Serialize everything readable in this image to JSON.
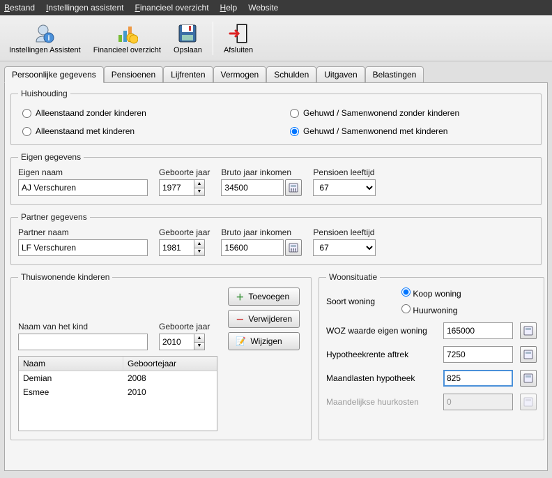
{
  "menu": {
    "bestand": "Bestand",
    "instellingen": "Instellingen assistent",
    "financieel": "Financieel overzicht",
    "help": "Help",
    "website": "Website"
  },
  "toolbar": {
    "instellingen": "Instellingen Assistent",
    "financieel": "Financieel overzicht",
    "opslaan": "Opslaan",
    "afsluiten": "Afsluiten"
  },
  "tabs": [
    "Persoonlijke gegevens",
    "Pensioenen",
    "Lijfrenten",
    "Vermogen",
    "Schulden",
    "Uitgaven",
    "Belastingen"
  ],
  "huishouding": {
    "legend": "Huishouding",
    "opt1": "Alleenstaand zonder kinderen",
    "opt2": "Gehuwd / Samenwonend zonder kinderen",
    "opt3": "Alleenstaand met kinderen",
    "opt4": "Gehuwd / Samenwonend met kinderen"
  },
  "eigen": {
    "legend": "Eigen gegevens",
    "naam_lbl": "Eigen naam",
    "naam": "AJ Verschuren",
    "geboorte_lbl": "Geboorte jaar",
    "geboorte": "1977",
    "bruto_lbl": "Bruto jaar inkomen",
    "bruto": "34500",
    "pensioen_lbl": "Pensioen leeftijd",
    "pensioen": "67"
  },
  "partner": {
    "legend": "Partner gegevens",
    "naam_lbl": "Partner naam",
    "naam": "LF Verschuren",
    "geboorte_lbl": "Geboorte jaar",
    "geboorte": "1981",
    "bruto_lbl": "Bruto jaar inkomen",
    "bruto": "15600",
    "pensioen_lbl": "Pensioen leeftijd",
    "pensioen": "67"
  },
  "kinderen": {
    "legend": "Thuiswonende kinderen",
    "naam_lbl": "Naam van het kind",
    "naam": "",
    "geboorte_lbl": "Geboorte jaar",
    "geboorte": "2010",
    "toevoegen": "Toevoegen",
    "verwijderen": "Verwijderen",
    "wijzigen": "Wijzigen",
    "th_naam": "Naam",
    "th_jaar": "Geboortejaar",
    "rows": [
      {
        "naam": "Demian",
        "jaar": "2008"
      },
      {
        "naam": "Esmee",
        "jaar": "2010"
      }
    ]
  },
  "woon": {
    "legend": "Woonsituatie",
    "soort_lbl": "Soort woning",
    "koop": "Koop woning",
    "huur": "Huurwoning",
    "woz_lbl": "WOZ waarde eigen woning",
    "woz": "165000",
    "hyp_lbl": "Hypotheekrente aftrek",
    "hyp": "7250",
    "maand_lbl": "Maandlasten hypotheek",
    "maand": "825",
    "huur_lbl": "Maandelijkse huurkosten",
    "huurv": "0"
  }
}
